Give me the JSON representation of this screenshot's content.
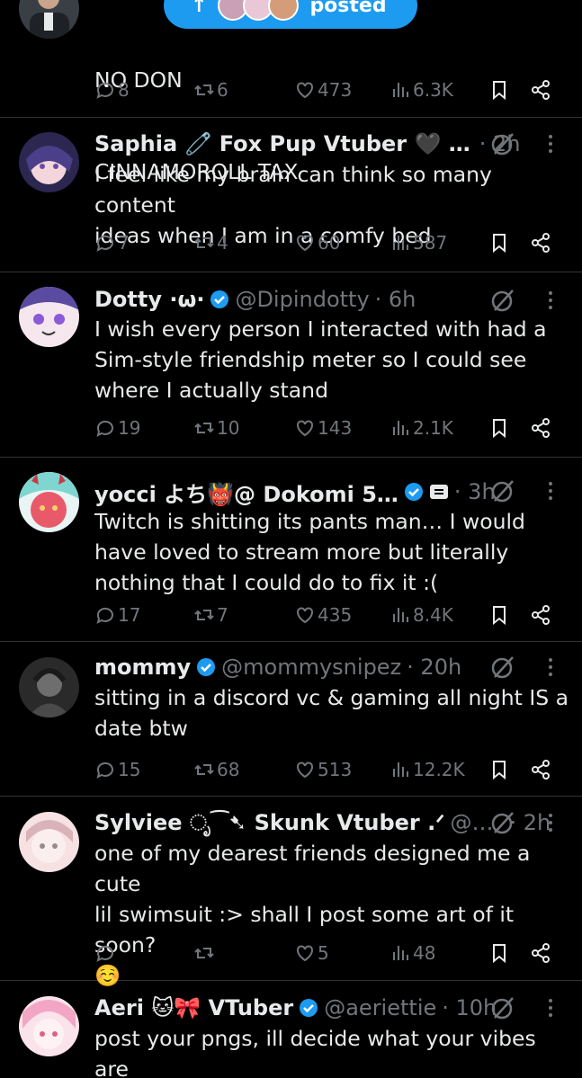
{
  "toast": {
    "label": "posted",
    "arrow": "↑"
  },
  "tweets": [
    {
      "text": "NO DȮ…\nCINNAMOROLL TAX",
      "text_lines": [
        "NO DON",
        "CINNAMOROLL TAX"
      ],
      "replies": "8",
      "reposts": "6",
      "likes": "473",
      "views": "6.3K"
    },
    {
      "name": "Saphia 🧷 Fox Pup Vtuber 🖤 …",
      "handle": "",
      "time": "· 2h",
      "verified": false,
      "text": "I feel like my brain can think so many content\nideas when I am in a comfy bed",
      "replies": "7",
      "reposts": "4",
      "likes": "60",
      "views": "587"
    },
    {
      "name": "Dotty ·ω·",
      "handle": "@Dipindotty",
      "time": "· 6h",
      "verified": true,
      "text": "I wish every person I interacted with had a\nSim-style friendship meter so I could see\nwhere I actually stand",
      "replies": "19",
      "reposts": "10",
      "likes": "143",
      "views": "2.1K"
    },
    {
      "name": "yocci よち👹@ Dokomi 5…",
      "handle": "",
      "time": "· 3h",
      "verified": true,
      "text": "Twitch is shitting its pants man… I would\nhave loved to stream more but literally\nnothing that I could do to fix it :(",
      "replies": "17",
      "reposts": "7",
      "likes": "435",
      "views": "8.4K"
    },
    {
      "name": "mommy",
      "handle": "@mommysnipez",
      "time": "· 20h",
      "verified": true,
      "text": "sitting in a discord vc & gaming all night IS a\ndate btw",
      "replies": "15",
      "reposts": "68",
      "likes": "513",
      "views": "12.2K"
    },
    {
      "name": "Sylviee ೃ⁀➷ Skunk Vtuber .ᐟ",
      "handle": "@…",
      "time": "· 2h",
      "verified": false,
      "text": "one of my dearest friends designed me a cute\nlil swimsuit :> shall I post some art of it soon?\n☺️",
      "replies": "",
      "reposts": "",
      "likes": "5",
      "views": "48"
    },
    {
      "name": "Aeri 🐱🎀 VTuber",
      "handle": "@aeriettie",
      "time": "· 10h",
      "verified": true,
      "text": "post your pngs, ill decide what your vibes are\non stream!"
    }
  ],
  "colors": {
    "background": "#000000",
    "muted": "#71767b",
    "text": "#e7e9ea",
    "accent": "#1d9bf0",
    "divider": "#2f3336"
  },
  "icons": [
    "reply-icon",
    "repost-icon",
    "like-icon",
    "views-icon",
    "bookmark-icon",
    "share-icon",
    "grok-icon",
    "more-icon",
    "verified-icon"
  ]
}
